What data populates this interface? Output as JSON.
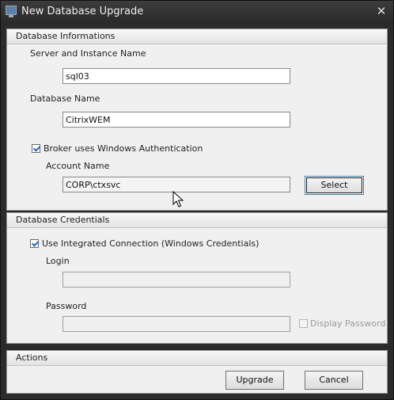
{
  "window": {
    "title": "New Database Upgrade",
    "close_glyph": "✕"
  },
  "db_info": {
    "header": "Database Informations",
    "server_label": "Server and Instance Name",
    "server_value": "sql03",
    "dbname_label": "Database Name",
    "dbname_value": "CitrixWEM",
    "windows_auth_label": "Broker uses Windows Authentication",
    "windows_auth_checked": true,
    "account_label": "Account Name",
    "account_value": "CORP\\ctxsvc",
    "select_button": "Select"
  },
  "credentials": {
    "header": "Database Credentials",
    "integrated_label": "Use Integrated Connection (Windows Credentials)",
    "integrated_checked": true,
    "login_label": "Login",
    "login_value": "",
    "password_label": "Password",
    "password_value": "",
    "display_password_label": "Display Password",
    "display_password_checked": false
  },
  "actions": {
    "header": "Actions",
    "upgrade_button": "Upgrade",
    "cancel_button": "Cancel"
  }
}
